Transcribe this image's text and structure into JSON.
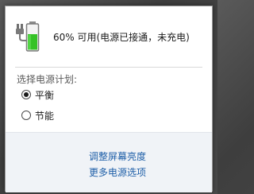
{
  "battery": {
    "icon": "battery-charging-icon",
    "status_text": "60% 可用(电源已接通，未充电)",
    "level": 0.6,
    "colors": {
      "fill": "#35c226",
      "plug": "#6a6a6a"
    }
  },
  "power_plan": {
    "label": "选择电源计划:",
    "options": [
      {
        "label": "平衡",
        "selected": true
      },
      {
        "label": "节能",
        "selected": false
      }
    ]
  },
  "links": {
    "adjust_brightness": "调整屏幕亮度",
    "more_power_options": "更多电源选项"
  },
  "colors": {
    "link": "#1e5fa8",
    "footer_bg": "#f0f3f7"
  }
}
